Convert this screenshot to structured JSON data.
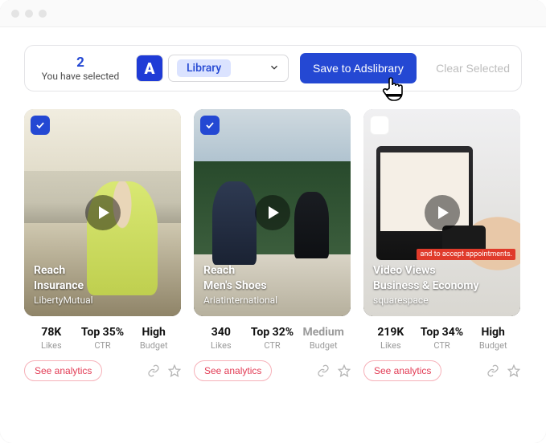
{
  "toolbar": {
    "selected_count": "2",
    "selected_label": "You have selected",
    "logo_letter": "A",
    "library_label": "Library",
    "save_label": "Save to Adslibrary",
    "clear_label": "Clear Selected"
  },
  "cards": [
    {
      "checked": true,
      "objective": "Reach",
      "category": "Insurance",
      "advertiser": "LibertyMutual",
      "likes_value": "78K",
      "likes_label": "Likes",
      "ctr_value": "Top 35%",
      "ctr_label": "CTR",
      "budget_value": "High",
      "budget_label": "Budget",
      "budget_muted": false,
      "analytics_label": "See analytics",
      "ribbon": null
    },
    {
      "checked": true,
      "objective": "Reach",
      "category": "Men's Shoes",
      "advertiser": "Ariatinternational",
      "likes_value": "340",
      "likes_label": "Likes",
      "ctr_value": "Top 32%",
      "ctr_label": "CTR",
      "budget_value": "Medium",
      "budget_label": "Budget",
      "budget_muted": true,
      "analytics_label": "See analytics",
      "ribbon": null
    },
    {
      "checked": false,
      "objective": "Video Views",
      "category": "Business & Economy",
      "advertiser": "squarespace",
      "likes_value": "219K",
      "likes_label": "Likes",
      "ctr_value": "Top 34%",
      "ctr_label": "CTR",
      "budget_value": "High",
      "budget_label": "Budget",
      "budget_muted": false,
      "analytics_label": "See analytics",
      "ribbon": "and to accept appointments."
    }
  ]
}
